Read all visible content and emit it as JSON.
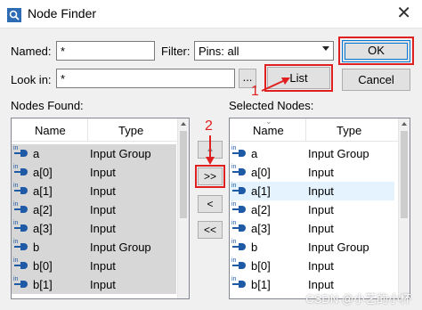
{
  "window": {
    "title": "Node Finder",
    "close_glyph": "✕"
  },
  "named": {
    "label": "Named:",
    "value": "*"
  },
  "filter": {
    "label": "Filter:",
    "value": "Pins: all"
  },
  "look_in": {
    "label": "Look in:",
    "value": "*",
    "browse_label": "..."
  },
  "buttons": {
    "ok": "OK",
    "list": "List",
    "cancel": "Cancel",
    "add": ">>",
    "remove": "<",
    "remove_all": "<<",
    "up": ""
  },
  "annotations": {
    "step1": "1",
    "step2": "2"
  },
  "nodes_found": {
    "label": "Nodes Found:",
    "columns": [
      "Name",
      "Type"
    ],
    "rows": [
      {
        "name": "a",
        "type": "Input Group"
      },
      {
        "name": "a[0]",
        "type": "Input"
      },
      {
        "name": "a[1]",
        "type": "Input"
      },
      {
        "name": "a[2]",
        "type": "Input"
      },
      {
        "name": "a[3]",
        "type": "Input"
      },
      {
        "name": "b",
        "type": "Input Group"
      },
      {
        "name": "b[0]",
        "type": "Input"
      },
      {
        "name": "b[1]",
        "type": "Input"
      }
    ]
  },
  "selected_nodes": {
    "label": "Selected Nodes:",
    "columns": [
      "Name",
      "Type"
    ],
    "rows": [
      {
        "name": "a",
        "type": "Input Group"
      },
      {
        "name": "a[0]",
        "type": "Input"
      },
      {
        "name": "a[1]",
        "type": "Input"
      },
      {
        "name": "a[2]",
        "type": "Input"
      },
      {
        "name": "a[3]",
        "type": "Input"
      },
      {
        "name": "b",
        "type": "Input Group"
      },
      {
        "name": "b[0]",
        "type": "Input"
      },
      {
        "name": "b[1]",
        "type": "Input"
      }
    ]
  },
  "pin_icon_label": "in",
  "watermark": "CSDN @小艺的小杯",
  "colors": {
    "accent": "#0078d7",
    "annotation": "#e02020",
    "pin": "#1f5aa6"
  }
}
